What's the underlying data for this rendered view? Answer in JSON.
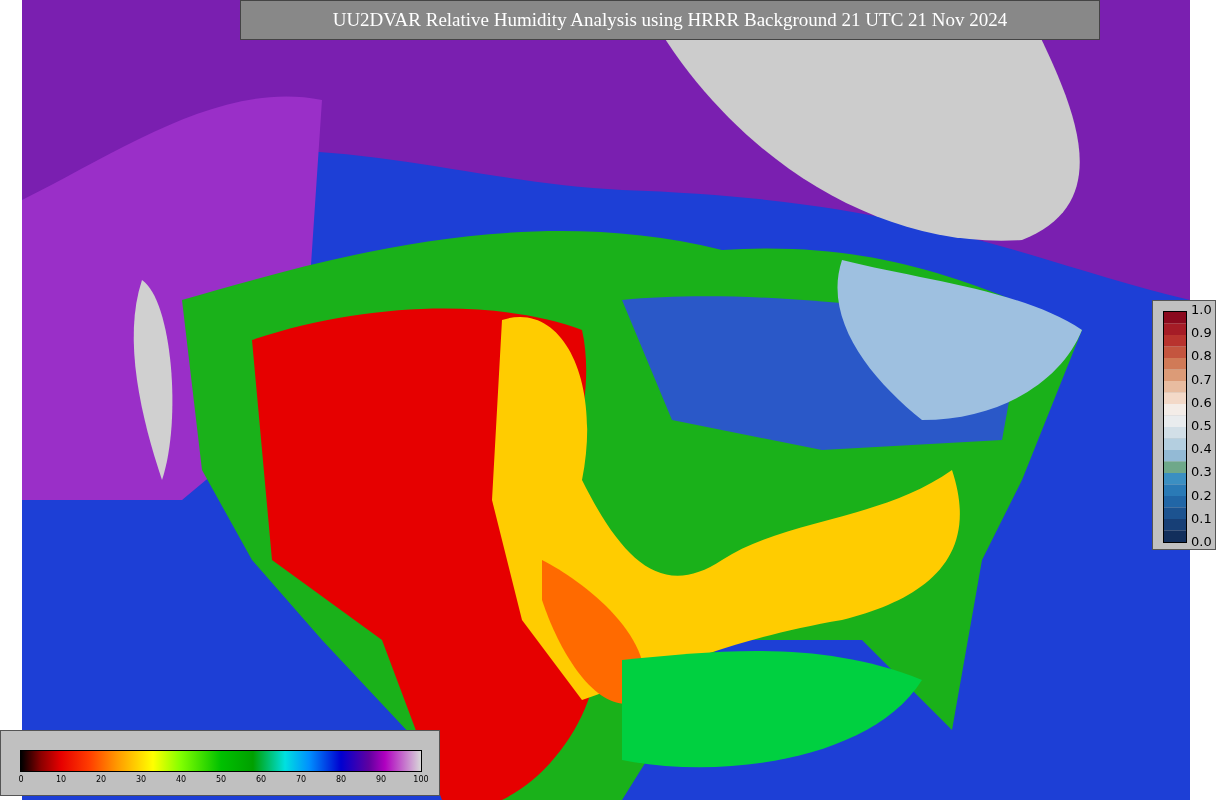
{
  "title": "UU2DVAR Relative Humidity Analysis using HRRR Background 21 UTC 21 Nov 2024",
  "right_colorbar": {
    "ticks": [
      "1.0",
      "0.9",
      "0.8",
      "0.7",
      "0.6",
      "0.5",
      "0.4",
      "0.3",
      "0.2",
      "0.1",
      "0.0"
    ]
  },
  "bottom_colorbar": {
    "ticks": [
      "0",
      "10",
      "20",
      "30",
      "40",
      "50",
      "60",
      "70",
      "80",
      "90",
      "100"
    ]
  }
}
